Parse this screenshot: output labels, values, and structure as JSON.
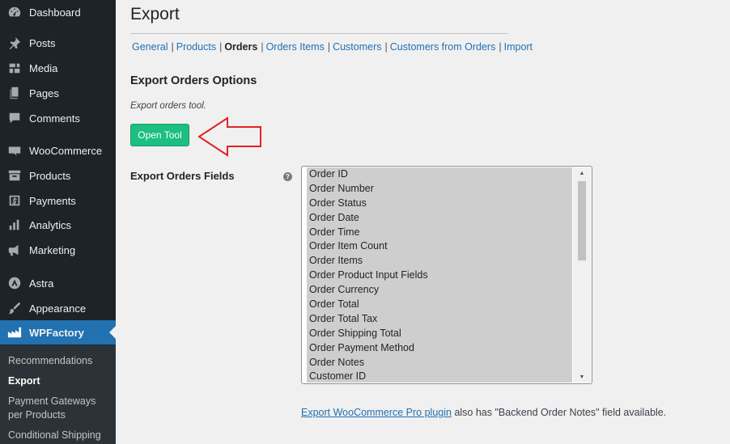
{
  "sidebar": {
    "items": [
      {
        "label": "Dashboard",
        "icon": "dashboard-icon"
      },
      {
        "label": "Posts",
        "icon": "pin-icon"
      },
      {
        "label": "Media",
        "icon": "media-icon"
      },
      {
        "label": "Pages",
        "icon": "pages-icon"
      },
      {
        "label": "Comments",
        "icon": "comment-icon"
      },
      {
        "label": "WooCommerce",
        "icon": "woo-icon"
      },
      {
        "label": "Products",
        "icon": "archive-icon"
      },
      {
        "label": "Payments",
        "icon": "payments-icon"
      },
      {
        "label": "Analytics",
        "icon": "analytics-icon"
      },
      {
        "label": "Marketing",
        "icon": "megaphone-icon"
      },
      {
        "label": "Astra",
        "icon": "astra-icon"
      },
      {
        "label": "Appearance",
        "icon": "paintbrush-icon"
      },
      {
        "label": "WPFactory",
        "icon": "wpfactory-icon"
      }
    ],
    "submenu": [
      {
        "label": "Recommendations"
      },
      {
        "label": "Export"
      },
      {
        "label": "Payment Gateways per Products"
      },
      {
        "label": "Conditional Shipping"
      }
    ],
    "active_color": "#2271b1"
  },
  "page": {
    "title": "Export",
    "subnav": [
      "General",
      "Products",
      "Orders",
      "Orders Items",
      "Customers",
      "Customers from Orders",
      "Import"
    ],
    "section_title": "Export Orders Options",
    "description": "Export orders tool.",
    "open_tool_label": "Open Tool",
    "fields_label": "Export Orders Fields",
    "help_icon": "?",
    "fields": [
      "Order ID",
      "Order Number",
      "Order Status",
      "Order Date",
      "Order Time",
      "Order Item Count",
      "Order Items",
      "Order Product Input Fields",
      "Order Currency",
      "Order Total",
      "Order Total Tax",
      "Order Shipping Total",
      "Order Payment Method",
      "Order Notes",
      "Customer ID"
    ],
    "footnote_link": "Export WooCommerce Pro plugin",
    "footnote_text": " also has \"Backend Order Notes\" field available.",
    "button_color": "#1cbf80",
    "arrow_color": "#e02424"
  }
}
